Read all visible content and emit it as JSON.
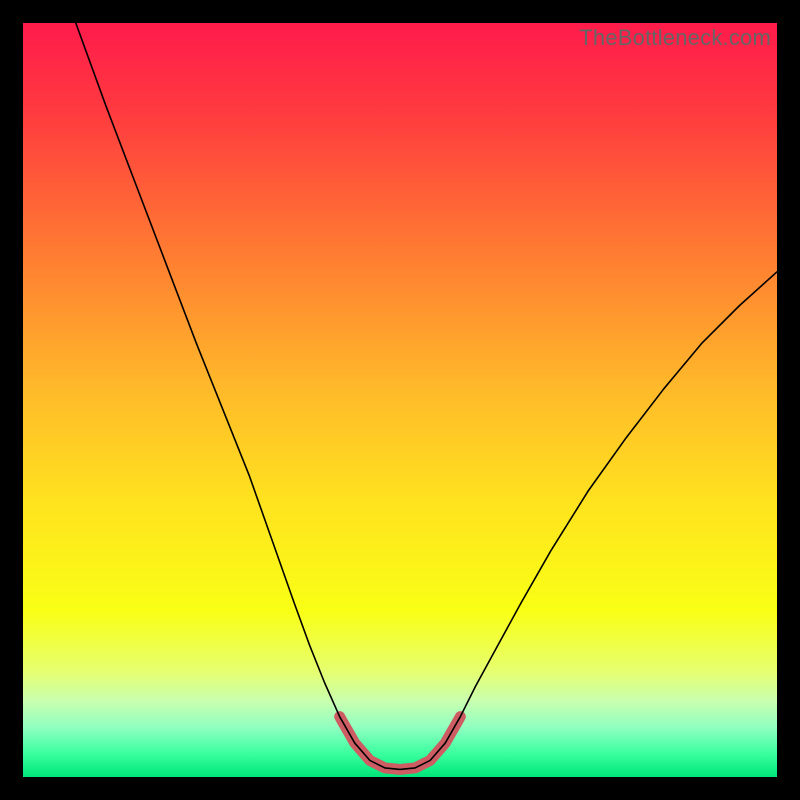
{
  "watermark": "TheBottleneck.com",
  "chart_data": {
    "type": "line",
    "title": "",
    "xlabel": "",
    "ylabel": "",
    "xlim": [
      0,
      100
    ],
    "ylim": [
      0,
      100
    ],
    "gradient_stops": [
      {
        "offset": 0,
        "color": "#ff1b4b"
      },
      {
        "offset": 0.12,
        "color": "#ff3b3f"
      },
      {
        "offset": 0.3,
        "color": "#ff7a32"
      },
      {
        "offset": 0.48,
        "color": "#ffb82a"
      },
      {
        "offset": 0.64,
        "color": "#ffe41e"
      },
      {
        "offset": 0.78,
        "color": "#f9ff15"
      },
      {
        "offset": 0.86,
        "color": "#e6ff70"
      },
      {
        "offset": 0.9,
        "color": "#c8ffb0"
      },
      {
        "offset": 0.935,
        "color": "#8effc0"
      },
      {
        "offset": 0.97,
        "color": "#38ff9e"
      },
      {
        "offset": 1.0,
        "color": "#00e47a"
      }
    ],
    "series": [
      {
        "name": "curve-black",
        "stroke": "#000000",
        "stroke_width": 1.6,
        "points": [
          {
            "x": 7.0,
            "y": 100.0
          },
          {
            "x": 11.0,
            "y": 89.0
          },
          {
            "x": 15.0,
            "y": 78.5
          },
          {
            "x": 19.0,
            "y": 68.0
          },
          {
            "x": 23.0,
            "y": 57.5
          },
          {
            "x": 27.0,
            "y": 47.5
          },
          {
            "x": 30.0,
            "y": 40.0
          },
          {
            "x": 33.0,
            "y": 31.5
          },
          {
            "x": 36.0,
            "y": 23.0
          },
          {
            "x": 38.0,
            "y": 17.5
          },
          {
            "x": 40.0,
            "y": 12.5
          },
          {
            "x": 42.0,
            "y": 8.0
          },
          {
            "x": 44.0,
            "y": 4.5
          },
          {
            "x": 46.0,
            "y": 2.2
          },
          {
            "x": 48.0,
            "y": 1.2
          },
          {
            "x": 50.0,
            "y": 1.0
          },
          {
            "x": 52.0,
            "y": 1.2
          },
          {
            "x": 54.0,
            "y": 2.2
          },
          {
            "x": 56.0,
            "y": 4.5
          },
          {
            "x": 58.0,
            "y": 8.0
          },
          {
            "x": 60.0,
            "y": 12.0
          },
          {
            "x": 63.0,
            "y": 17.5
          },
          {
            "x": 66.0,
            "y": 23.0
          },
          {
            "x": 70.0,
            "y": 30.0
          },
          {
            "x": 75.0,
            "y": 38.0
          },
          {
            "x": 80.0,
            "y": 45.0
          },
          {
            "x": 85.0,
            "y": 51.5
          },
          {
            "x": 90.0,
            "y": 57.5
          },
          {
            "x": 95.0,
            "y": 62.5
          },
          {
            "x": 100.0,
            "y": 67.0
          }
        ]
      },
      {
        "name": "highlight-coral",
        "stroke": "#cd5d62",
        "stroke_width": 11,
        "linecap": "round",
        "points": [
          {
            "x": 42.0,
            "y": 8.0
          },
          {
            "x": 44.0,
            "y": 4.5
          },
          {
            "x": 46.0,
            "y": 2.2
          },
          {
            "x": 48.0,
            "y": 1.2
          },
          {
            "x": 50.0,
            "y": 1.0
          },
          {
            "x": 52.0,
            "y": 1.2
          },
          {
            "x": 54.0,
            "y": 2.2
          },
          {
            "x": 56.0,
            "y": 4.5
          },
          {
            "x": 58.0,
            "y": 8.0
          }
        ]
      }
    ]
  }
}
